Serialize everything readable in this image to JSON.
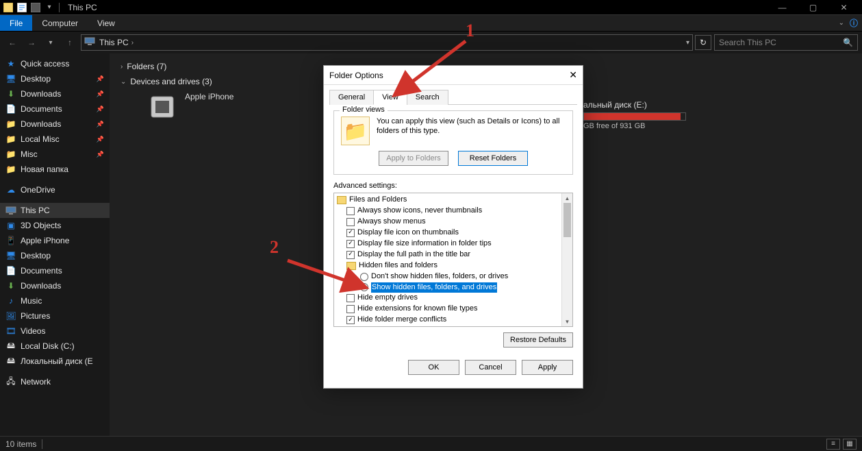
{
  "titlebar": {
    "title": "This PC"
  },
  "win_controls": {
    "min": "—",
    "max": "▢",
    "close": "✕"
  },
  "menubar": {
    "file": "File",
    "computer": "Computer",
    "view": "View",
    "help_icon": "?"
  },
  "nav": {
    "back": "←",
    "forward": "→",
    "dropdown": "▾",
    "up": "↑",
    "crumb_root": "This PC",
    "crumb_sep": "›",
    "addr_dd": "▾",
    "refresh": "↻"
  },
  "search": {
    "placeholder": "Search This PC",
    "icon": "🔍"
  },
  "sidebar": {
    "quick": "Quick access",
    "desktop": "Desktop",
    "downloads1": "Downloads",
    "documents1": "Documents",
    "downloads2": "Downloads",
    "localmisc": "Local Misc",
    "misc": "Misc",
    "newfolder": "Новая папка",
    "onedrive": "OneDrive",
    "thispc": "This PC",
    "objects3d": "3D Objects",
    "iphone": "Apple iPhone",
    "desktop2": "Desktop",
    "documents2": "Documents",
    "downloads3": "Downloads",
    "music": "Music",
    "pictures": "Pictures",
    "videos": "Videos",
    "localc": "Local Disk (C:)",
    "locale": "Локальный диск (E",
    "network": "Network"
  },
  "content": {
    "folders_header": "Folders (7)",
    "devices_header": "Devices and drives (3)",
    "iphone_label": "Apple iPhone",
    "driveE": {
      "name": "альный диск (E:)",
      "sub": "GB free of 931 GB"
    }
  },
  "statusbar": {
    "items": "10 items"
  },
  "dialog": {
    "title": "Folder Options",
    "close": "✕",
    "tabs": {
      "general": "General",
      "view": "View",
      "search": "Search"
    },
    "fv": {
      "legend": "Folder views",
      "text": "You can apply this view (such as Details or Icons) to all folders of this type.",
      "apply": "Apply to Folders",
      "reset": "Reset Folders"
    },
    "adv_label": "Advanced settings:",
    "tree": {
      "root": "Files and Folders",
      "i1": "Always show icons, never thumbnails",
      "i2": "Always show menus",
      "i3": "Display file icon on thumbnails",
      "i4": "Display file size information in folder tips",
      "i5": "Display the full path in the title bar",
      "hidden": "Hidden files and folders",
      "r1": "Don't show hidden files, folders, or drives",
      "r2": "Show hidden files, folders, and drives",
      "i6": "Hide empty drives",
      "i7": "Hide extensions for known file types",
      "i8": "Hide folder merge conflicts"
    },
    "restore": "Restore Defaults",
    "ok": "OK",
    "cancel": "Cancel",
    "apply_btn": "Apply"
  },
  "annot": {
    "n1": "1",
    "n2": "2"
  }
}
